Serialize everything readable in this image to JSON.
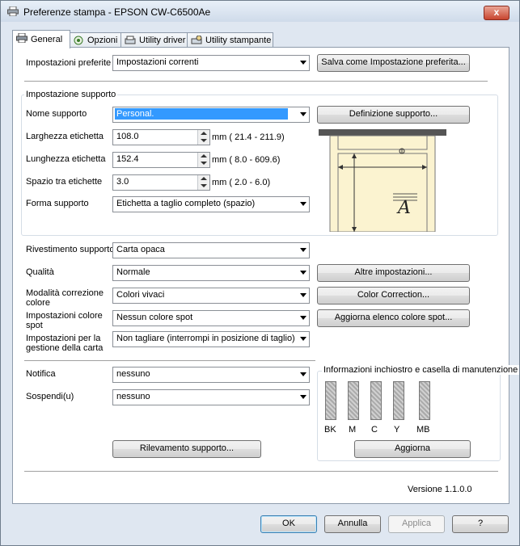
{
  "window": {
    "title": "Preferenze stampa - EPSON CW-C6500Ae",
    "close_label": "x"
  },
  "tabs": [
    {
      "label": "General"
    },
    {
      "label": "Opzioni"
    },
    {
      "label": "Utility driver"
    },
    {
      "label": "Utility stampante"
    }
  ],
  "preferred": {
    "label": "Impostazioni preferite",
    "value": "Impostazioni correnti",
    "save_button": "Salva come Impostazione preferita..."
  },
  "media": {
    "group_label": "Impostazione supporto",
    "name_label": "Nome supporto",
    "name_value": "Personal.",
    "definition_button": "Definizione supporto...",
    "width_label": "Larghezza etichetta",
    "width_value": "108.0",
    "width_range": "mm ( 21.4 - 211.9)",
    "length_label": "Lunghezza etichetta",
    "length_value": "152.4",
    "length_range": "mm ( 8.0 - 609.6)",
    "gap_label": "Spazio tra etichette",
    "gap_value": "3.0",
    "gap_range": "mm ( 2.0 -  6.0)",
    "shape_label": "Forma supporto",
    "shape_value": "Etichetta a taglio completo (spazio)",
    "preview_glyph": "A",
    "coating_label": "Rivestimento supporto",
    "coating_value": "Carta opaca"
  },
  "quality": {
    "label": "Qualità",
    "value": "Normale",
    "more_button": "Altre impostazioni..."
  },
  "color_correction": {
    "label": "Modalità correzione colore",
    "value": "Colori vivaci",
    "button": "Color Correction..."
  },
  "spot": {
    "label": "Impostazioni colore spot",
    "value": "Nessun colore spot",
    "button": "Aggiorna elenco colore spot..."
  },
  "paper_handling": {
    "label": "Impostazioni per la gestione della carta",
    "value": "Non tagliare (interrompi in posizione di taglio)"
  },
  "notify": {
    "label": "Notifica",
    "value": "nessuno"
  },
  "suspend": {
    "label": "Sospendi(u)",
    "value": "nessuno"
  },
  "detect_button": "Rilevamento supporto...",
  "ink": {
    "group_label": "Informazioni inchiostro e casella di manutenzione",
    "cartridges": [
      {
        "label": "BK",
        "icon": "ink-cartridge-icon",
        "level": 1.0
      },
      {
        "label": "M",
        "icon": "ink-cartridge-icon",
        "level": 1.0
      },
      {
        "label": "C",
        "icon": "ink-cartridge-icon",
        "level": 1.0
      },
      {
        "label": "Y",
        "icon": "ink-cartridge-icon",
        "level": 1.0
      },
      {
        "label": "MB",
        "icon": "maintenance-box-icon",
        "level": 1.0
      }
    ],
    "update_button": "Aggiorna"
  },
  "version": "Versione 1.1.0.0",
  "footer": {
    "ok": "OK",
    "cancel": "Annulla",
    "apply": "Applica",
    "help": "?"
  },
  "colors": {
    "selection": "#3399ff",
    "close_button": "#c8452f",
    "frame": "#dfe7f1"
  }
}
